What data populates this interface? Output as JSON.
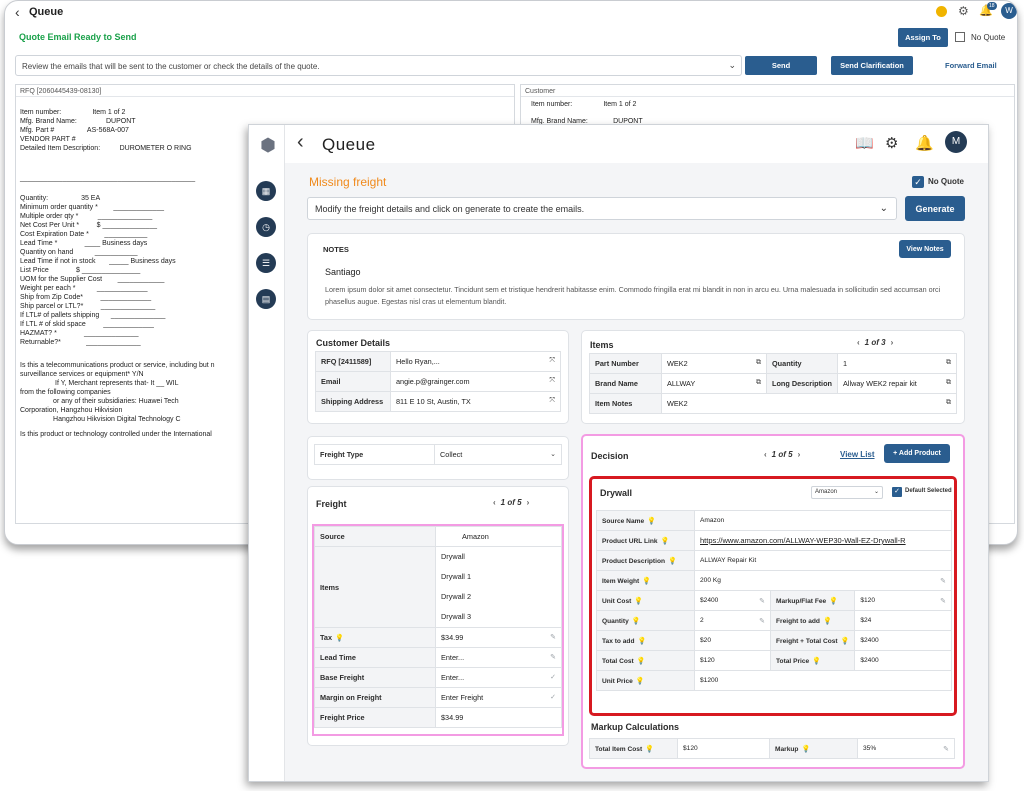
{
  "back": {
    "title": "Queue",
    "status": "Quote Email Ready to Send",
    "notif_count": "18",
    "avatar": "W",
    "assign_label": "Assign To",
    "no_quote_label": "No Quote",
    "review_text": "Review the emails that will be sent to the customer or check the details of the quote.",
    "send_label": "Send",
    "send_clar_label": "Send Clarification",
    "forward_label": "Forward Email",
    "rfq_panel_title": "RFQ [2060445439-08130]",
    "customer_panel_title": "Customer",
    "left_rows": [
      "Item number:                Item 1 of 2",
      "Mfg. Brand Name:               DUPONT",
      "Mfg. Part #                 AS-568A-007",
      "VENDOR PART #",
      "Detailed Item Description:          DUROMETER O RING",
      "_____________________________________________",
      "Quantity:                 35 EA",
      "Minimum order quantity *        _____________",
      "Multiple order qty *          ______________",
      "Net Cost Per Unit *         $ ______________",
      "Cost Expiration Date *        ___________",
      "Lead Time *              ____ Business days",
      "Quantity on hand           ___________",
      "Lead Time if not in stock       _____ Business days",
      "List Price              $ _______________",
      "UOM for the Supplier Cost        ____________",
      "Weight per each *           _____________",
      "Ship from Zip Code*         _____________",
      "Ship parcel or LTL?*         ______________",
      "If LTL# of pallets shipping      ______________",
      "If LTL # of skid space         _____________",
      "HAZMAT? *              ______________",
      "Returnable?*             ______________",
      "Is this a telecommunications product or service, including but n",
      "surveillance services or equipment* Y/N",
      "                  If Y, Merchant represents that- It __ WIL",
      "from the following companies",
      "                 or any of their subsidiaries: Huawei Tech",
      "Corporation, Hangzhou Hikvision",
      "                 Hangzhou Hikvision Digital Technology C",
      "Is this product or technology controlled under the International"
    ],
    "right_rows": [
      "Item number:                Item 1 of 2",
      "Mfg. Brand Name:             DUPONT"
    ]
  },
  "front": {
    "title": "Queue",
    "avatar": "M",
    "missing_label": "Missing freight",
    "no_quote_label": "No Quote",
    "modify_text": "Modify the freight details and click on generate to create the emails.",
    "generate_label": "Generate",
    "notes": {
      "title": "NOTES",
      "view_notes_label": "View Notes",
      "name": "Santiago",
      "text": "Lorem ipsum dolor sit amet consectetur. Tincidunt sem et tristique hendrerit habitasse enim. Commodo fringilla erat mi blandit in non in arcu eu. Urna malesuada in sollicitudin sed accumsan orci phasellus augue. Egestas nisl cras ut elementum blandit."
    },
    "customer_details": {
      "title": "Customer Details",
      "rows": [
        {
          "key": "RFQ [2411589]",
          "value": "Hello Ryan,..."
        },
        {
          "key": "Email",
          "value": "angie.p@grainger.com"
        },
        {
          "key": "Shipping Address",
          "value": "811 E 10 St, Austin, TX"
        }
      ]
    },
    "items": {
      "title": "Items",
      "pager": "1 of 3",
      "part_number_label": "Part Number",
      "part_number": "WEK2",
      "quantity_label": "Quantity",
      "quantity": "1",
      "brand_name_label": "Brand Name",
      "brand_name": "ALLWAY",
      "long_desc_label": "Long Description",
      "long_desc": "Allway WEK2 repair kit",
      "item_notes_label": "Item Notes",
      "item_notes": "WEK2"
    },
    "freight_type": {
      "label": "Freight Type",
      "value": "Collect"
    },
    "freight": {
      "title": "Freight",
      "pager": "1 of 5",
      "source_label": "Source",
      "source": "Amazon",
      "items_label": "Items",
      "items": [
        "Drywall",
        "Drywall 1",
        "Drywall 2",
        "Drywall 3"
      ],
      "tax_label": "Tax",
      "tax": "$34.99",
      "lead_time_label": "Lead Time",
      "lead_time_placeholder": "Enter...",
      "base_freight_label": "Base Freight",
      "base_freight_placeholder": "Enter...",
      "margin_label": "Margin on Freight",
      "margin_placeholder": "Enter Freight",
      "freight_price_label": "Freight Price",
      "freight_price": "$34.99"
    },
    "decision": {
      "title": "Decision",
      "pager": "1 of 5",
      "view_list_label": "View List",
      "add_product_label": "+ Add Product",
      "product_title": "Drywall",
      "source_select": "Amazon",
      "default_selected_label": "Default Selected",
      "source_name_label": "Source Name",
      "source_name": "Amazon",
      "product_url_label": "Product URL Link",
      "product_url": "https://www.amazon.com/ALLWAY-WEP30-Wall-EZ-Drywall-R",
      "product_desc_label": "Product Description",
      "product_desc": "ALLWAY Repair Kit",
      "item_weight_label": "Item Weight",
      "item_weight": "200 Kg",
      "unit_cost_label": "Unit Cost",
      "unit_cost": "$2400",
      "markup_fee_label": "Markup/Flat Fee",
      "markup_fee": "$120",
      "quantity_label": "Quantity",
      "quantity": "2",
      "freight_to_add_label": "Freight to add",
      "freight_to_add": "$24",
      "tax_to_add_label": "Tax to add",
      "tax_to_add": "$20",
      "freight_total_cost_label": "Freight + Total Cost",
      "freight_total_cost": "$2400",
      "total_cost_label": "Total Cost",
      "total_cost": "$120",
      "total_price_label": "Total Price",
      "total_price": "$2400",
      "unit_price_label": "Unit Price",
      "unit_price": "$1200"
    },
    "markup": {
      "title": "Markup Calculations",
      "total_item_cost_label": "Total Item Cost",
      "total_item_cost": "$120",
      "markup_label": "Markup",
      "markup_value": "35%"
    }
  },
  "colors": {
    "primary": "#2a5d8f",
    "status_green": "#1aa14a",
    "warning_orange": "#f08a1c",
    "highlight_pink": "#f39be3",
    "highlight_red": "#d71920"
  }
}
